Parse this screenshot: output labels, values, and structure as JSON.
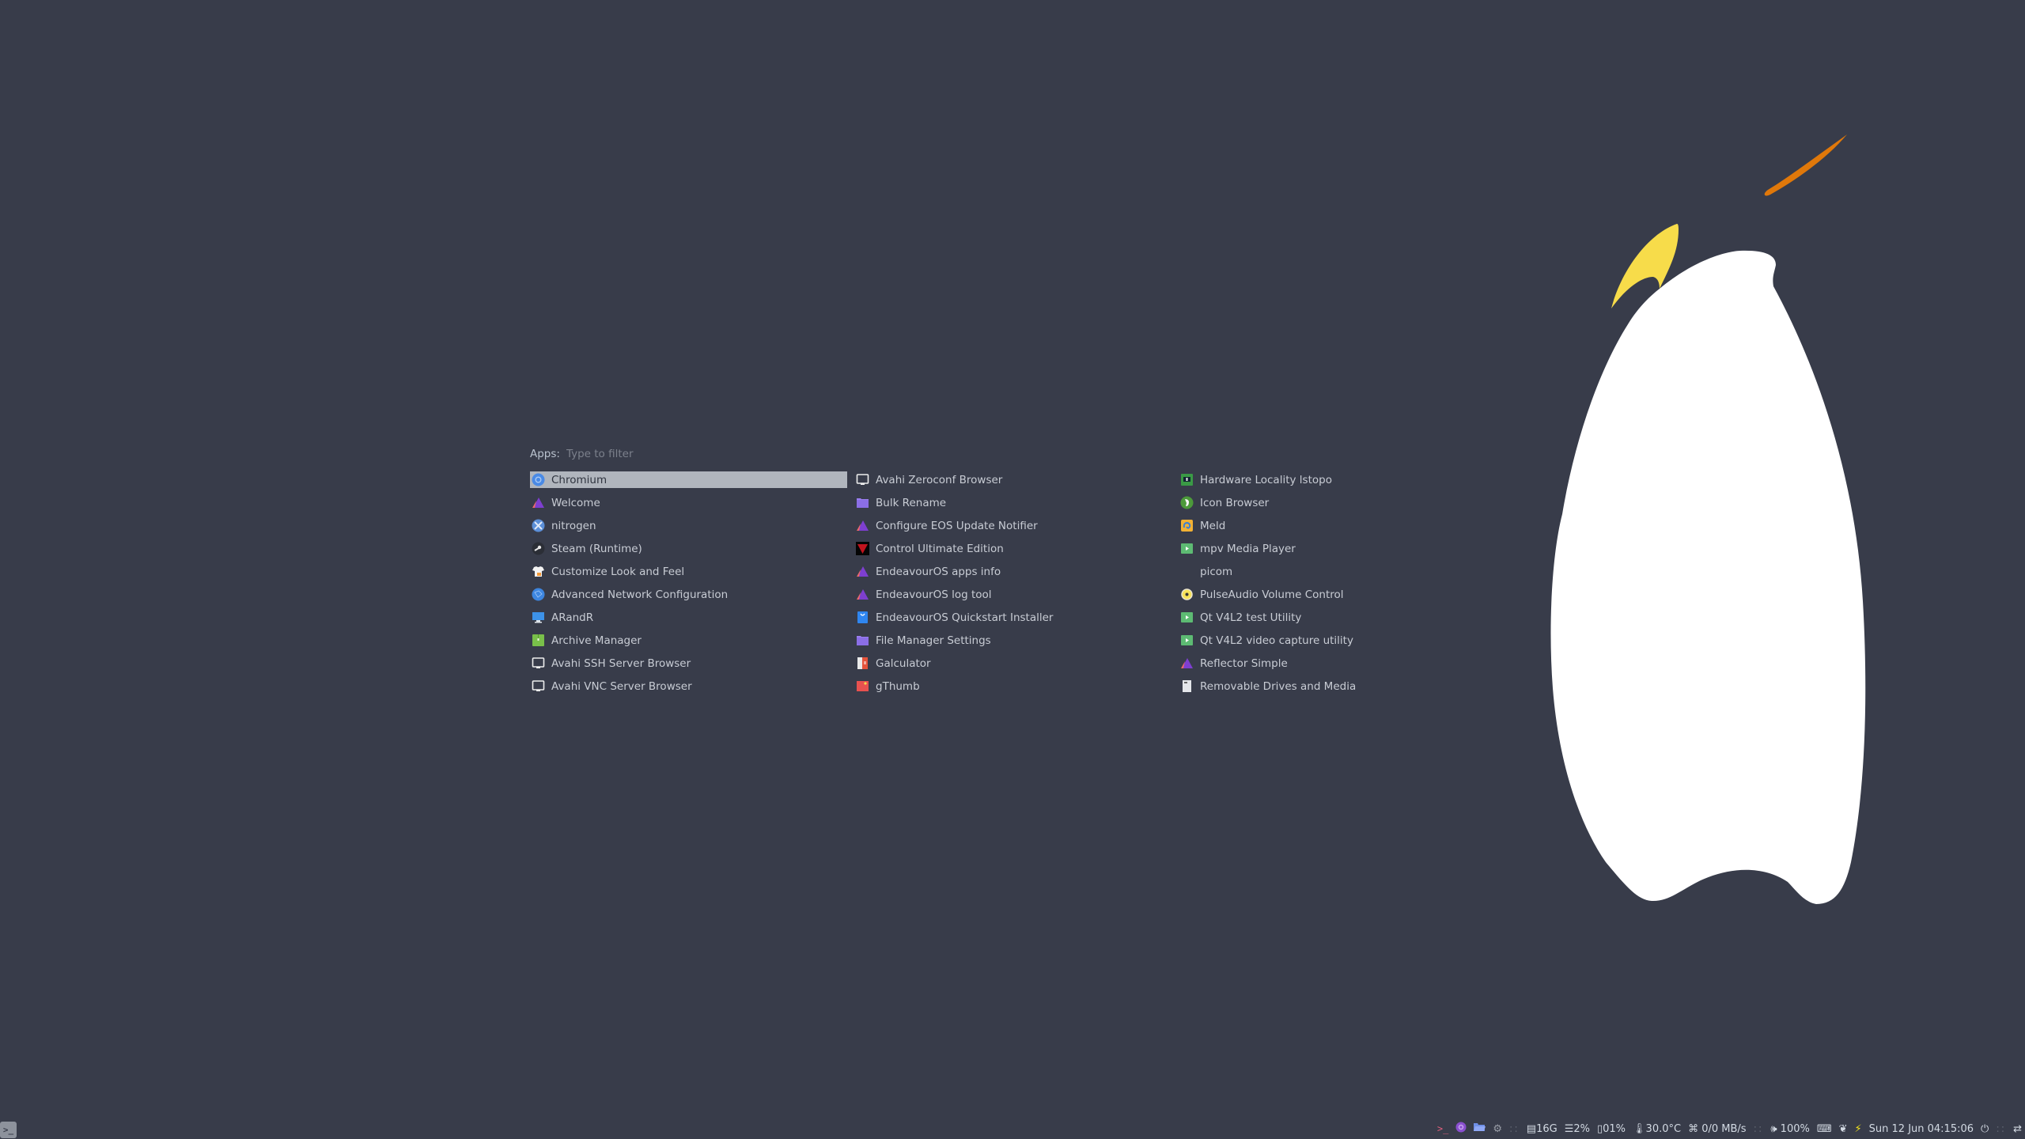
{
  "launcher": {
    "prompt_label": "Apps:",
    "placeholder": "Type to filter",
    "columns": [
      [
        {
          "label": "Chromium",
          "icon": "chromium-icon",
          "selected": true
        },
        {
          "label": "Welcome",
          "icon": "endeavouros-icon"
        },
        {
          "label": "nitrogen",
          "icon": "nitrogen-icon"
        },
        {
          "label": "Steam (Runtime)",
          "icon": "steam-icon"
        },
        {
          "label": "Customize Look and Feel",
          "icon": "shirt-icon"
        },
        {
          "label": "Advanced Network Configuration",
          "icon": "network-globe-icon"
        },
        {
          "label": "ARandR",
          "icon": "monitor-icon"
        },
        {
          "label": "Archive Manager",
          "icon": "archive-icon"
        },
        {
          "label": "Avahi SSH Server Browser",
          "icon": "screen-outline-icon"
        },
        {
          "label": "Avahi VNC Server Browser",
          "icon": "screen-outline-icon"
        }
      ],
      [
        {
          "label": "Avahi Zeroconf Browser",
          "icon": "screen-outline-icon"
        },
        {
          "label": "Bulk Rename",
          "icon": "folder-icon"
        },
        {
          "label": "Configure EOS Update Notifier",
          "icon": "endeavouros-icon"
        },
        {
          "label": "Control Ultimate Edition",
          "icon": "control-ue-icon"
        },
        {
          "label": "EndeavourOS apps info",
          "icon": "endeavouros-icon"
        },
        {
          "label": "EndeavourOS log tool",
          "icon": "endeavouros-icon"
        },
        {
          "label": "EndeavourOS Quickstart Installer",
          "icon": "shopping-bag-icon"
        },
        {
          "label": "File Manager Settings",
          "icon": "folder-icon"
        },
        {
          "label": "Galculator",
          "icon": "calculator-icon"
        },
        {
          "label": "gThumb",
          "icon": "image-viewer-icon"
        }
      ],
      [
        {
          "label": "Hardware Locality lstopo",
          "icon": "hardware-board-icon"
        },
        {
          "label": "Icon Browser",
          "icon": "gimp-icon"
        },
        {
          "label": "Meld",
          "icon": "meld-icon"
        },
        {
          "label": "mpv Media Player",
          "icon": "play-icon"
        },
        {
          "label": "picom",
          "icon": "blank-icon"
        },
        {
          "label": "PulseAudio Volume Control",
          "icon": "speaker-disc-icon"
        },
        {
          "label": "Qt V4L2 test Utility",
          "icon": "play-icon"
        },
        {
          "label": "Qt V4L2 video capture utility",
          "icon": "play-icon"
        },
        {
          "label": "Reflector Simple",
          "icon": "endeavouros-icon"
        },
        {
          "label": "Removable Drives and Media",
          "icon": "drive-icon"
        }
      ]
    ]
  },
  "statusbar": {
    "launcher_icon": "terminal-icon",
    "disk": "16G",
    "memory": "2%",
    "cpu": "01%",
    "temperature": "30.0°C",
    "network": "0/0 MB/s",
    "volume": "100%",
    "clock": "Sun 12 Jun 04:15:06",
    "separator": "::"
  },
  "colors": {
    "background": "#383c4a",
    "selection": "#b0b5bd",
    "penguin_body": "#ffffff",
    "penguin_beak": "#f7dc4a",
    "penguin_accent": "#e0780a"
  }
}
